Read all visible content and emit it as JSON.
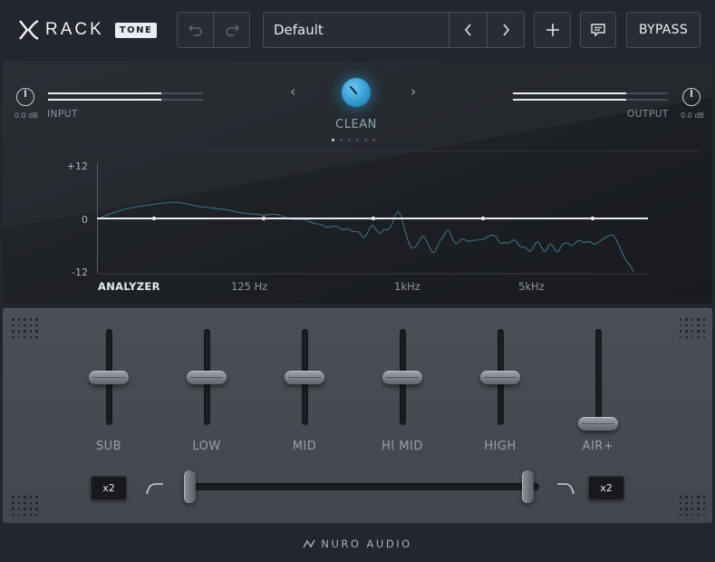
{
  "brand": {
    "name": "RACK",
    "tag": "TONE"
  },
  "toolbar": {
    "preset_name": "Default",
    "bypass_label": "BYPASS"
  },
  "input": {
    "label": "INPUT",
    "gain": "0.0 dB",
    "level": 0.73
  },
  "output": {
    "label": "OUTPUT",
    "gain": "0.0 dB",
    "level": 0.73
  },
  "mode": {
    "label": "CLEAN",
    "pages": 6,
    "active_page": 0
  },
  "analyzer": {
    "label": "ANALYZER",
    "y_ticks": [
      "+12",
      "0",
      "-12"
    ],
    "x_ticks": [
      "125 Hz",
      "1kHz",
      "5kHz"
    ]
  },
  "bands": [
    {
      "label": "SUB",
      "level": 0.5
    },
    {
      "label": "LOW",
      "level": 0.5
    },
    {
      "label": "MID",
      "level": 0.5
    },
    {
      "label": "HI MID",
      "level": 0.5
    },
    {
      "label": "HIGH",
      "level": 0.5
    },
    {
      "label": "AIR+",
      "level": 0.0
    }
  ],
  "filters": {
    "low_cut_multiplier": "x2",
    "high_cut_multiplier": "x2",
    "low_cut_position": 0.0,
    "high_cut_position": 1.0
  },
  "footer": {
    "brand": "NURO AUDIO"
  },
  "colors": {
    "accent": "#2e97cf",
    "text": "#cfd5dc",
    "panel_lower": "#464a51"
  }
}
